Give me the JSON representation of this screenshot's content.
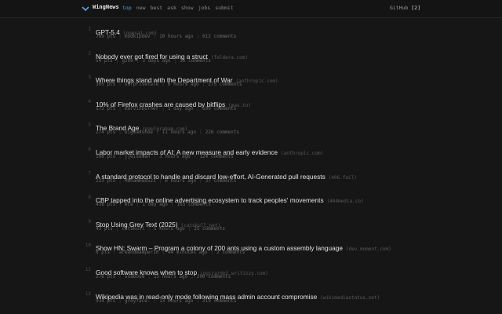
{
  "header": {
    "brand": "WingNews",
    "nav": [
      "top",
      "new",
      "best",
      "ask",
      "show",
      "jobs",
      "submit"
    ],
    "active_nav": "top",
    "github_label": "GitHub",
    "github_count": "[2]",
    "accent_color": "#5aa0e8"
  },
  "stories": [
    {
      "rank": "1",
      "title": "GPT-5.4",
      "domain": "(openai.com)",
      "points": "789 pts",
      "user": "mudkipdev",
      "age": "10 hours ago",
      "comments": "612 comments"
    },
    {
      "rank": "2",
      "title": "Nobody ever got fired for using a struct",
      "domain": "(feldera.com)",
      "points": "54 pts",
      "user": "gz09",
      "age": "3 days ago",
      "comments": "35 comments"
    },
    {
      "rank": "3",
      "title": "Where things stand with the Department of War",
      "domain": "(anthropic.com)",
      "points": "305 pts",
      "user": "surprisetalk",
      "age": "6 hours ago",
      "comments": "275 comments"
    },
    {
      "rank": "4",
      "title": "10% of Firefox crashes are caused by bitflips",
      "domain": "(mas.to)",
      "points": "172 pts",
      "user": "marvinborner",
      "age": "1 day ago",
      "comments": "109 comments"
    },
    {
      "rank": "5",
      "title": "The Brand Age",
      "domain": "(paulgraham.com)",
      "points": "274 pts",
      "user": "bigmadshoe",
      "age": "11 hours ago",
      "comments": "226 comments"
    },
    {
      "rank": "6",
      "title": "Labor market impacts of AI: A new measure and early evidence",
      "domain": "(anthropic.com)",
      "points": "108 pts",
      "user": "jjwiseman",
      "age": "3 hours ago",
      "comments": "124 comments"
    },
    {
      "rank": "7",
      "title": "A standard protocol to handle and discard low-effort, AI-Generated pull requests",
      "domain": "(406.fail)",
      "points": "123 pts",
      "user": "Muhammad523",
      "age": "6 hours ago",
      "comments": "37 comments"
    },
    {
      "rank": "8",
      "title": "CBP tapped into the online advertising ecosystem to track peoples' movements",
      "domain": "(404media.co)",
      "points": "438 pts",
      "user": "ece",
      "age": "1 day ago",
      "comments": "165 comments"
    },
    {
      "rank": "9",
      "title": "Stop Using Grey Text (2025)",
      "domain": "(catskull.net)",
      "points": "43 pts",
      "user": "catskull",
      "age": "5 hours ago",
      "comments": "25 comments"
    },
    {
      "rank": "10",
      "title": "Show HN: Swarm – Program a colony of 200 ants using a custom assembly language",
      "domain": "(dev.moment.com)",
      "points": "6 pts",
      "user": "armandwamper10",
      "age": "44 minutes ago",
      "comments": "2 comments"
    },
    {
      "rank": "11",
      "title": "Good software knows when to stop",
      "domain": "(ogirardot.writizzy.com)",
      "points": "276 pts",
      "user": "ssaboum",
      "age": "15 hours ago",
      "comments": "200 comments"
    },
    {
      "rank": "12",
      "title": "Wikipedia was in read-only mode following mass admin account compromise",
      "domain": "(wikimediastatus.net)",
      "points": "934 pts",
      "user": "greyface-",
      "age": "13 hours ago",
      "comments": "319 comments"
    }
  ]
}
